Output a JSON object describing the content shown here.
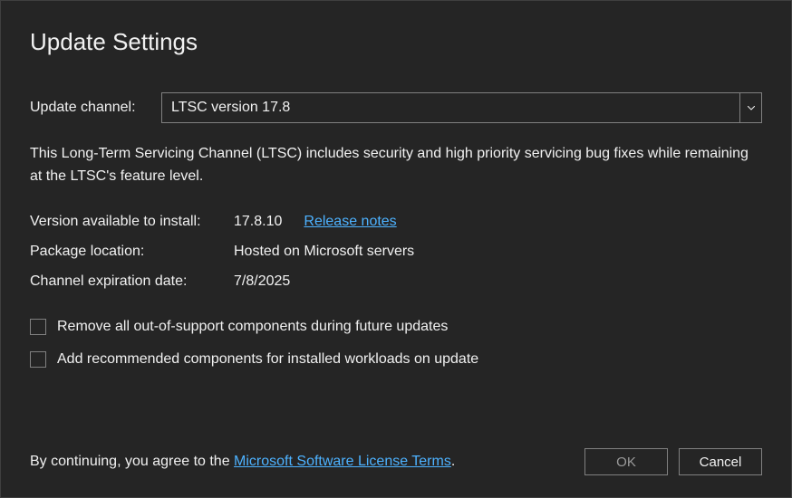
{
  "title": "Update Settings",
  "channel": {
    "label": "Update channel:",
    "selected": "LTSC version 17.8"
  },
  "description": "This Long-Term Servicing Channel (LTSC) includes security and high priority servicing bug fixes while remaining at the LTSC's feature level.",
  "info": {
    "version_label": "Version available to install:",
    "version_value": "17.8.10",
    "release_notes": "Release notes",
    "package_label": "Package location:",
    "package_value": "Hosted on Microsoft servers",
    "expiration_label": "Channel expiration date:",
    "expiration_value": "7/8/2025"
  },
  "checkboxes": {
    "remove_out_of_support": "Remove all out-of-support components during future updates",
    "add_recommended": "Add recommended components for installed workloads on update"
  },
  "footer": {
    "agree_prefix": "By continuing, you agree to the ",
    "license_link": "Microsoft Software License Terms",
    "agree_suffix": ".",
    "ok": "OK",
    "cancel": "Cancel"
  }
}
